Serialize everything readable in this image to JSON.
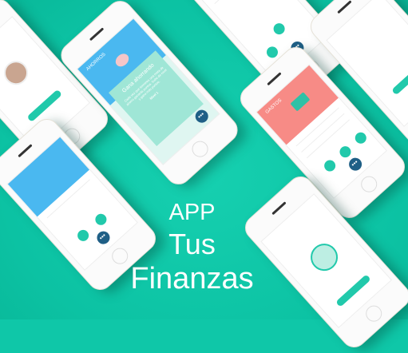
{
  "headline": {
    "line1": "APP",
    "line2": "Tus",
    "line3": "Finanzas"
  },
  "savings_screen": {
    "title": "AHORROS",
    "card_title": "Gana ahorrando",
    "card_text": "Cada vez que termines una meta de ahorro ganarás puntos. Sube de nivel y gana más puntos.",
    "level": "Nivel 1"
  },
  "expenses_screen": {
    "title": "GASTOS"
  },
  "colors": {
    "background": "#0fc7a8",
    "savings_header": "#4ab8f0",
    "expenses_header": "#f78b86",
    "accent": "#21c9ab",
    "fab": "#1f5f86"
  }
}
